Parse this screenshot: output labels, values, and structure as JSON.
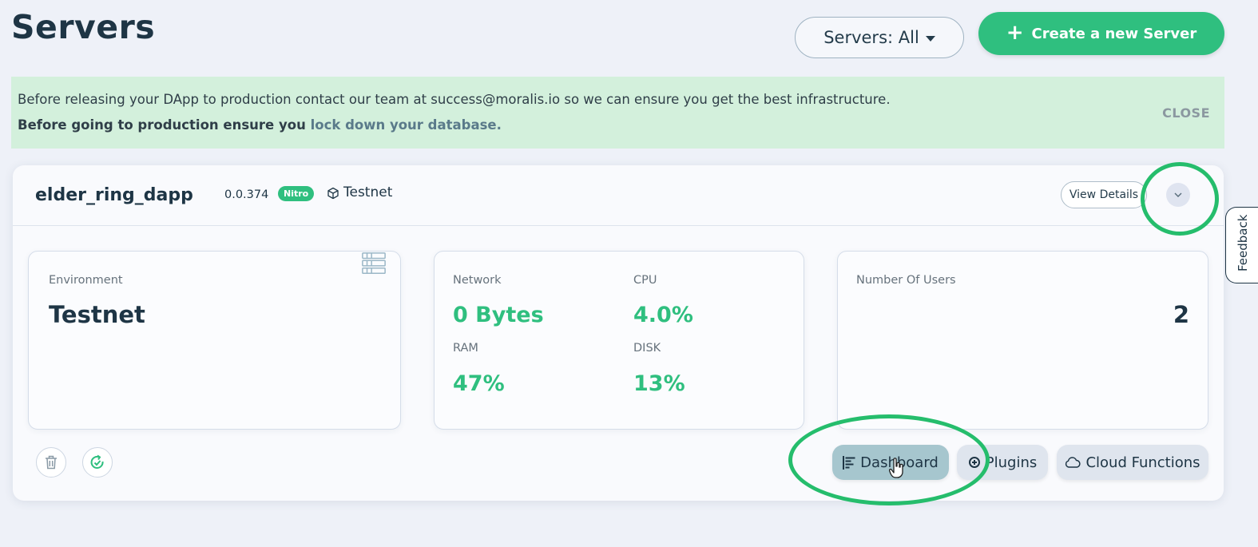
{
  "header": {
    "title": "Servers",
    "filter_label": "Servers: All",
    "create_label": "Create a new Server"
  },
  "banner": {
    "line1": "Before releasing your DApp to production contact our team at success@moralis.io so we can ensure you get the best infrastructure.",
    "line2_prefix": "Before going to production ensure you ",
    "line2_link": "lock down your database.",
    "close_label": "CLOSE"
  },
  "server": {
    "name": "elder_ring_dapp",
    "version": "0.0.374",
    "badge": "Nitro",
    "network": "Testnet",
    "view_details_label": "View Details",
    "environment": {
      "label": "Environment",
      "value": "Testnet"
    },
    "stats": {
      "network_label": "Network",
      "network_value": "0 Bytes",
      "cpu_label": "CPU",
      "cpu_value": "4.0%",
      "ram_label": "RAM",
      "ram_value": "47%",
      "disk_label": "DISK",
      "disk_value": "13%"
    },
    "users": {
      "label": "Number Of Users",
      "value": "2"
    },
    "actions": {
      "dashboard": "Dashboard",
      "plugins": "Plugins",
      "cloud_functions": "Cloud Functions"
    }
  },
  "feedback_label": "Feedback",
  "colors": {
    "accent": "#2fbf7f",
    "banner_bg": "#d3f0dc",
    "annotation": "#25bd6c"
  }
}
